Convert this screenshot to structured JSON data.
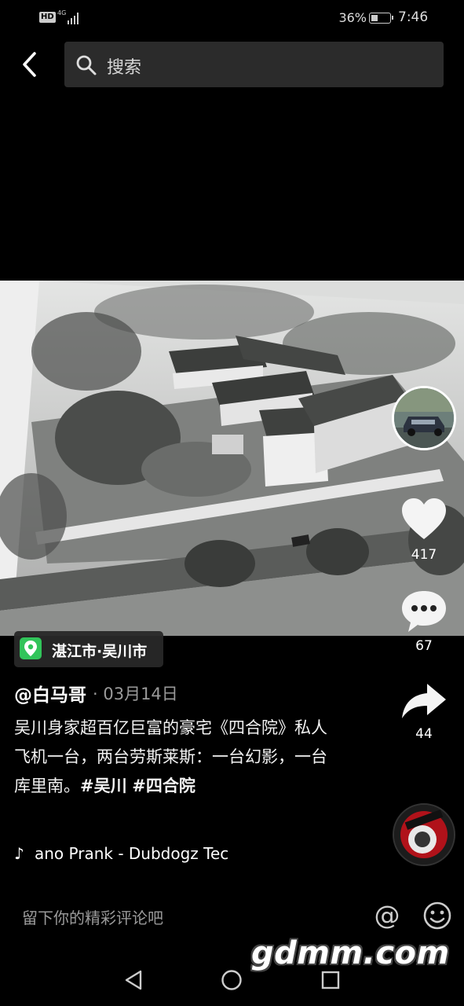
{
  "status_bar": {
    "hd_label": "HD",
    "network_label": "4G",
    "battery_percent": "36%",
    "battery_level": 0.36,
    "time": "7:46"
  },
  "search": {
    "placeholder": "搜索",
    "back_icon": "chevron-left-icon",
    "search_icon": "magnifier-icon"
  },
  "post": {
    "likes": "417",
    "comments": "67",
    "shares": "44",
    "location": "湛江市·吴川市",
    "author": "@白马哥",
    "date": "· 03月14日",
    "caption_text": "吴川身家超百亿巨富的豪宅《四合院》私人飞机一台，两台劳斯莱斯：一台幻影，一台库里南。",
    "hashtags": [
      "#吴川",
      "#四合院"
    ],
    "music": "ano Prank - Dubdogz    Tec"
  },
  "comment_bar": {
    "placeholder": "留下你的精彩评论吧"
  },
  "watermark": "gdmm.com",
  "colors": {
    "background": "#000000",
    "location_pin": "#31c45a",
    "search_bg": "#2b2b2b"
  }
}
